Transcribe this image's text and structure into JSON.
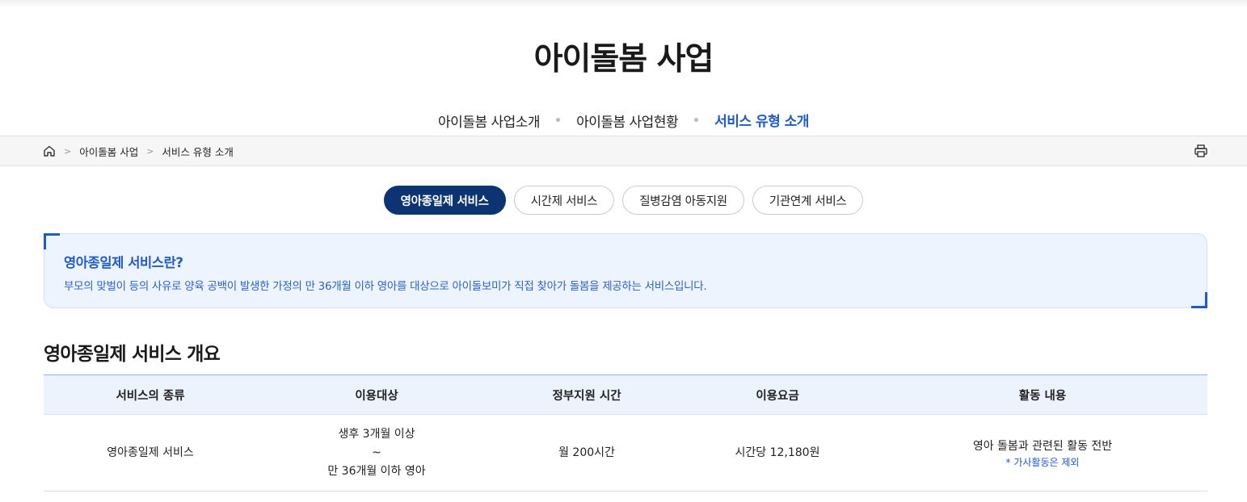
{
  "page": {
    "title": "아이돌봄 사업"
  },
  "tabs": [
    {
      "label": "아이돌봄 사업소개"
    },
    {
      "label": "아이돌봄 사업현황"
    },
    {
      "label": "서비스 유형 소개"
    }
  ],
  "breadcrumb": {
    "home_icon": "home-icon",
    "items": [
      {
        "label": "아이돌봄 사업"
      },
      {
        "label": "서비스 유형 소개"
      }
    ],
    "print_icon": "print-icon"
  },
  "service_tabs": [
    {
      "label": "영아종일제 서비스"
    },
    {
      "label": "시간제 서비스"
    },
    {
      "label": "질병감염 아동지원"
    },
    {
      "label": "기관연계 서비스"
    }
  ],
  "info": {
    "title": "영아종일제 서비스란?",
    "desc": "부모의 맞벌이 등의 사유로 양육 공백이 발생한 가정의 만 36개월 이하 영아를 대상으로 아이돌보미가 직접 찾아가 돌봄을 제공하는 서비스입니다."
  },
  "overview": {
    "title": "영아종일제 서비스 개요",
    "headers": [
      "서비스의 종류",
      "이용대상",
      "정부지원 시간",
      "이용요금",
      "활동 내용"
    ],
    "row": {
      "type": "영아종일제 서비스",
      "target_line1": "생후 3개월 이상",
      "target_line2": "~",
      "target_line3": "만 36개월 이하 영아",
      "hours": "월 200시간",
      "fee": "시간당 12,180원",
      "activity": "영아 돌봄과 관련된 활동 전반",
      "activity_note": "* 가사활동은 제외"
    }
  },
  "colors": {
    "accent": "#1e5bc8",
    "active_pill": "#0c3472",
    "info_bg": "#eef4fd",
    "table_header_bg": "#ecf3fd"
  }
}
